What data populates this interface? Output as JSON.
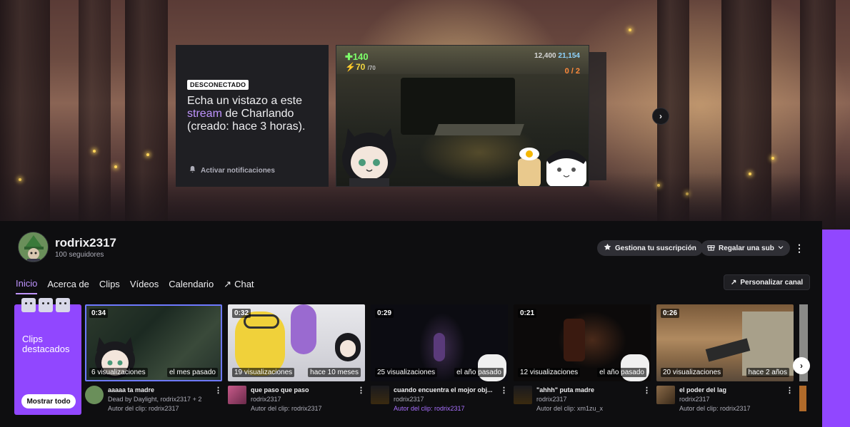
{
  "offline_card": {
    "badge": "DESCONECTADO",
    "text_before": "Echa un vistazo a este",
    "link": "stream",
    "text_after": "de Charlando (creado: hace 3 horas).",
    "notify_label": "Activar notificaciones"
  },
  "video_preview": {
    "health": "✚140",
    "armor": "⚡70",
    "armor_max": "/70",
    "score": "12,400",
    "score2": "21,154",
    "ammo": "0 / 2"
  },
  "channel": {
    "name": "rodrix2317",
    "followers": "100 seguidores",
    "manage_sub_label": "Gestiona tu suscripción",
    "gift_sub_label": "Regalar una sub",
    "customize_label": "Personalizar canal"
  },
  "tabs": [
    {
      "label": "Inicio",
      "active": true
    },
    {
      "label": "Acerca de"
    },
    {
      "label": "Clips"
    },
    {
      "label": "Vídeos"
    },
    {
      "label": "Calendario"
    },
    {
      "label": "Chat"
    }
  ],
  "featured": {
    "label_line1": "Clips",
    "label_line2": "destacados",
    "show_all_label": "Mostrar todo"
  },
  "clips": [
    {
      "duration": "0:34",
      "views": "6 visualizaciones",
      "age": "el mes pasado",
      "title": "aaaaa ta madre",
      "line2": "Dead by Daylight, rodrix2317 + 2",
      "line3": "Autor del clip: rodrix2317"
    },
    {
      "duration": "0:32",
      "views": "19 visualizaciones",
      "age": "hace 10 meses",
      "title": "que paso que paso",
      "line2": "rodrix2317",
      "line3": "Autor del clip: rodrix2317"
    },
    {
      "duration": "0:29",
      "views": "25 visualizaciones",
      "age": "el año pasado",
      "title": "cuando encuentra el mojor obj...",
      "line2": "rodrix2317",
      "line3": "Autor del clip: rodrix2317"
    },
    {
      "duration": "0:21",
      "views": "12 visualizaciones",
      "age": "el año pasado",
      "title": "\"ahhh\" puta madre",
      "line2": "rodrix2317",
      "line3": "Autor del clip: xm1zu_x"
    },
    {
      "duration": "0:26",
      "views": "20 visualizaciones",
      "age": "hace 2 años",
      "title": "el poder del lag",
      "line2": "rodrix2317",
      "line3": "Autor del clip: rodrix2317"
    }
  ],
  "icons": {
    "next": "›",
    "kebab": "⋮",
    "chat_arrow": "↗"
  },
  "colors": {
    "accent": "#9147ff",
    "accent_text": "#bf94ff",
    "background": "#0e0e10",
    "selected_outline": "#6e79ff"
  }
}
